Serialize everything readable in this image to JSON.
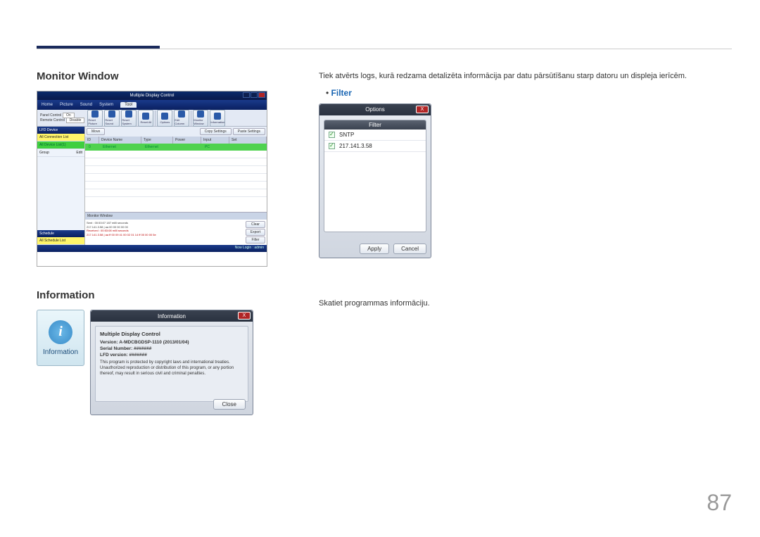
{
  "page_number": "87",
  "sections": {
    "monitor": {
      "title": "Monitor Window",
      "desc": "Tiek atvērts logs, kurā redzama detalizēta informācija par datu pārsūtīšanu starp datoru un displeja ierīcēm.",
      "filter_label": "Filter"
    },
    "information": {
      "title": "Information",
      "desc": "Skatiet programmas informāciju."
    }
  },
  "mdc": {
    "app_title": "Multiple Display Control",
    "menu": [
      "Home",
      "Picture",
      "Sound",
      "System"
    ],
    "menu_active": "Tool",
    "panel_ctl_label": "Panel Control",
    "panel_ctl_value": "On",
    "remote_ctl_label": "Remote Control",
    "remote_ctl_value": "Disable",
    "toolbar": [
      "Reset Picture",
      "Reset Sound",
      "Reset System",
      "Reset All",
      "Options",
      "Edit Column",
      "Monitor Window",
      "Information"
    ],
    "btn_move": "Move",
    "btn_copy": "Copy Settings",
    "btn_paste": "Paste Settings",
    "side_hdr1": "LFD Device",
    "side_items1": [
      "All Connection List",
      "All Device List(1)",
      "Group"
    ],
    "side_edit": "Edit",
    "side_hdr2": "Schedule",
    "side_items2": [
      "All Schedule List"
    ],
    "col_hdrs": [
      "ID",
      "Device Name",
      "Type",
      "Power",
      "Input",
      "Set"
    ],
    "row_vals": [
      "0",
      "Ethernet",
      "Ethernet",
      "",
      "PC",
      ""
    ],
    "mon_title": "Monitor Window",
    "mon_log1": "Sent : 00:53:07 187 milli seconds",
    "mon_log2": "217.141.3.58 | aa 00 00 00 00 00",
    "mon_log3": "Received : 00:53:08 milli seconds",
    "mon_log4": "217.141.3.58 | aa ff 00 09 41 00 02 01 14 ff 00 00 00 5e",
    "mon_btn_clear": "Clear",
    "mon_btn_export": "Export",
    "mon_btn_filter": "Filter",
    "status": "Now Login : admin"
  },
  "filter_dlg": {
    "title": "Options",
    "list_hdr": "Filter",
    "rows": [
      "SNTP",
      "217.141.3.58"
    ],
    "btn_apply": "Apply",
    "btn_cancel": "Cancel"
  },
  "info_icon": {
    "glyph": "i",
    "label": "Information"
  },
  "info_dlg": {
    "title": "Information",
    "heading": "Multiple Display Control",
    "version": "Version: A-MDCBGDSP-1110 (2013/01/04)",
    "serial": "Serial Number: #######",
    "lfd": "LFD version: #######",
    "copyright": "This program is protected by copyright laws and international treaties. Unauthorized reproduction or distribution of this program, or any portion thereof, may result in serious civil and criminal penalties.",
    "btn_close": "Close"
  }
}
